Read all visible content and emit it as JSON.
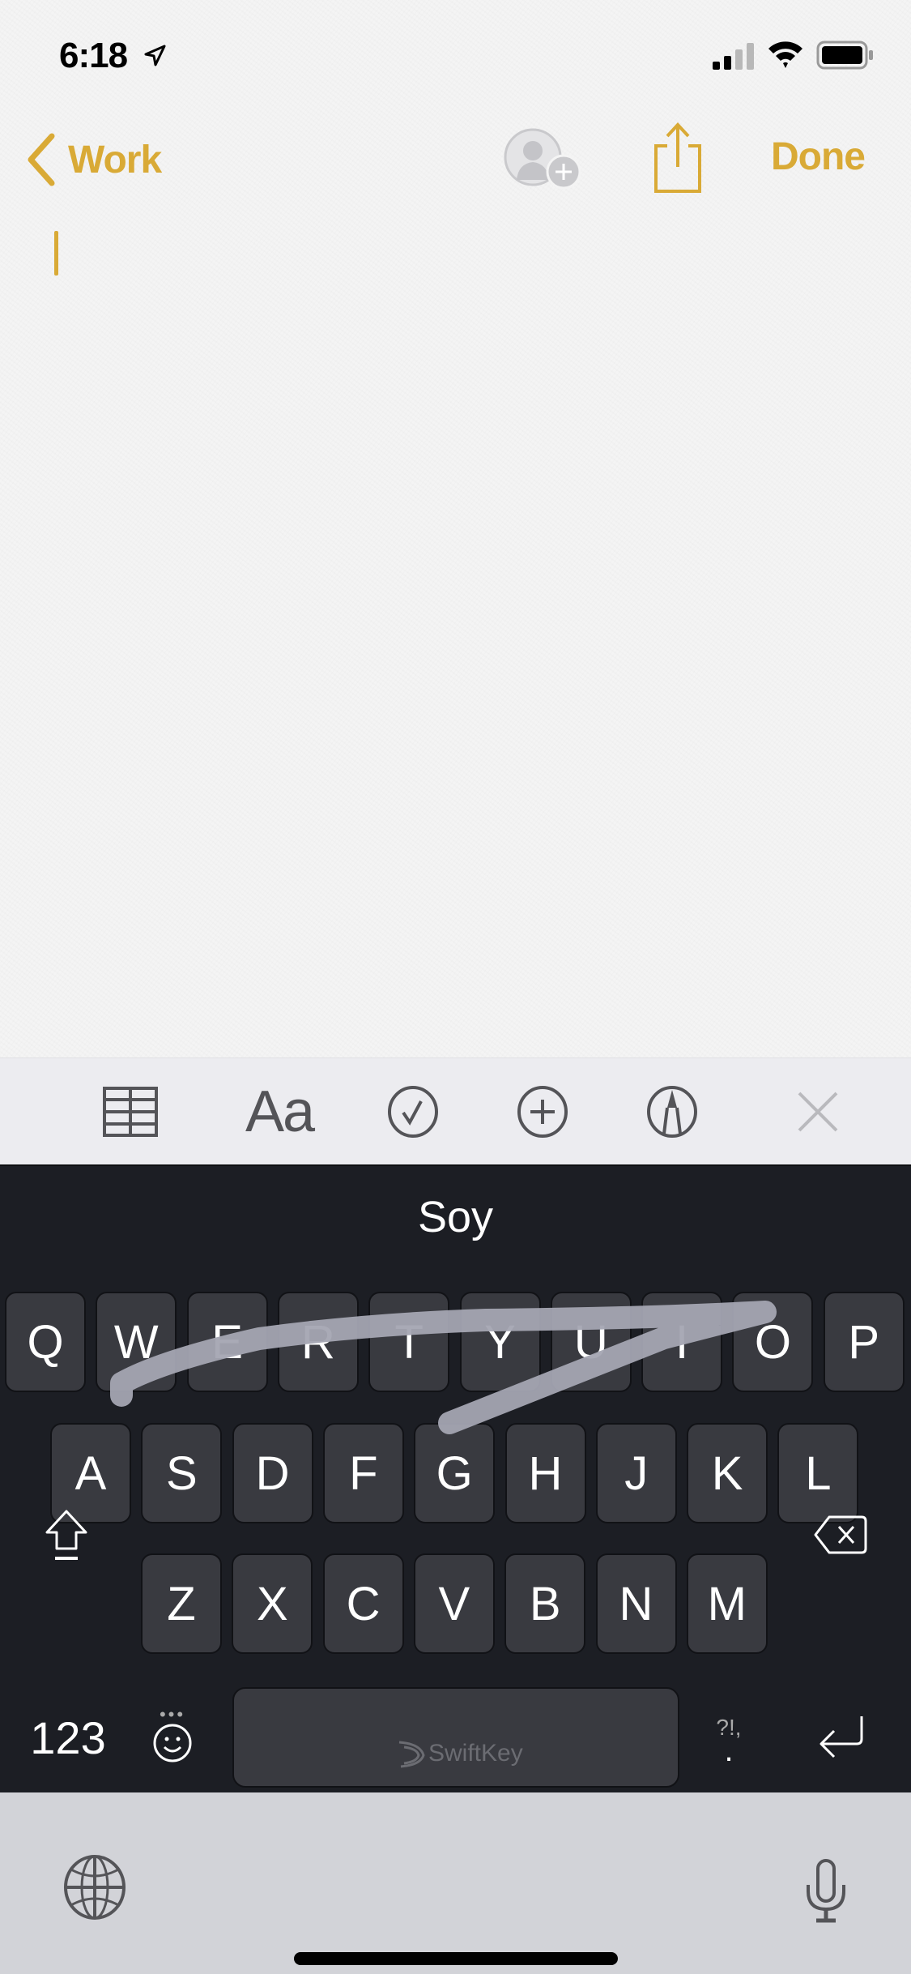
{
  "status_bar": {
    "time": "6:18",
    "icons": [
      "location-arrow-icon",
      "cellular-signal-icon",
      "wifi-icon",
      "battery-icon"
    ],
    "signal_bars_active": 2,
    "signal_bars_total": 4
  },
  "nav": {
    "back_label": "Work",
    "done_label": "Done",
    "icons": [
      "chevron-left-icon",
      "add-people-icon",
      "share-icon"
    ]
  },
  "note": {
    "body": ""
  },
  "toolbar": {
    "items": [
      {
        "name": "table-button",
        "icon": "table-icon"
      },
      {
        "name": "format-button",
        "label": "Aa"
      },
      {
        "name": "checklist-button",
        "icon": "checkmark-circle-icon"
      },
      {
        "name": "insert-button",
        "icon": "plus-circle-icon"
      },
      {
        "name": "markup-button",
        "icon": "pen-circle-icon"
      },
      {
        "name": "close-keyboard-button",
        "icon": "close-icon"
      }
    ]
  },
  "keyboard": {
    "suggestion": "Soy",
    "rows": [
      [
        "Q",
        "W",
        "E",
        "R",
        "T",
        "Y",
        "U",
        "I",
        "O",
        "P"
      ],
      [
        "A",
        "S",
        "D",
        "F",
        "G",
        "H",
        "J",
        "K",
        "L"
      ],
      [
        "Z",
        "X",
        "C",
        "V",
        "B",
        "N",
        "M"
      ]
    ],
    "numbers_label": "123",
    "punctuation_label": "?!,",
    "punctuation_secondary": ".",
    "space_brand": "SwiftKey",
    "swipe_path_keys": [
      "W",
      "E",
      "R",
      "T",
      "Y",
      "U",
      "I",
      "O",
      "G"
    ],
    "colors": {
      "background": "#1c1e24",
      "key": "#393a40",
      "trail": "#a4a5b2"
    }
  },
  "system_bar": {
    "icons": [
      "globe-icon",
      "microphone-icon"
    ]
  },
  "colors": {
    "accent": "#d9aa36",
    "toolbar_bg": "#ececf0",
    "toolbar_icon": "#545458"
  }
}
